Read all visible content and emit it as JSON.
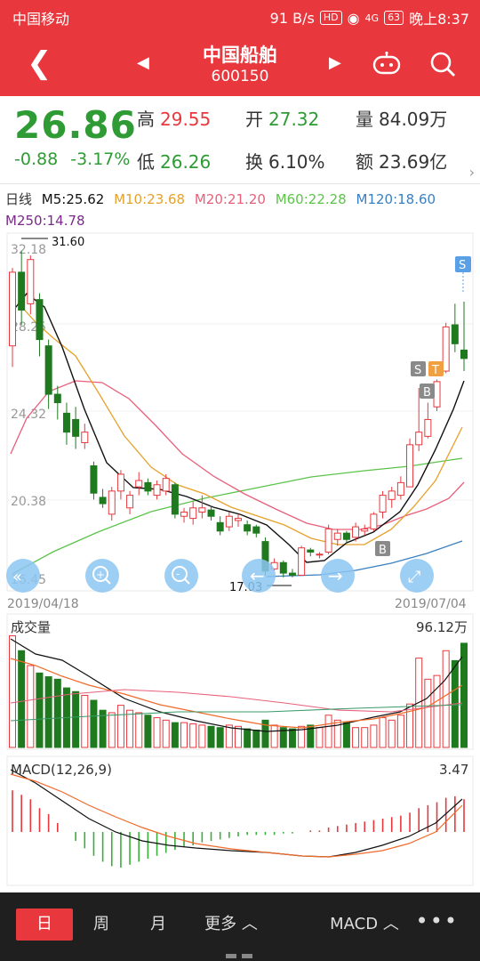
{
  "status_bar": {
    "carrier": "中国移动",
    "net_speed": "91 B/s",
    "hd": "HD",
    "signal": "4G",
    "battery": "63",
    "time": "晚上8:37"
  },
  "header": {
    "title": "中国船舶",
    "code": "600150"
  },
  "quote": {
    "price": "26.86",
    "change": "-0.88",
    "change_pct": "-3.17%",
    "high_label": "高",
    "high": "29.55",
    "low_label": "低",
    "low": "26.26",
    "open_label": "开",
    "open": "27.32",
    "turnover_label": "换",
    "turnover": "6.10%",
    "volume_label": "量",
    "volume": "84.09万",
    "amount_label": "额",
    "amount": "23.69亿"
  },
  "ma_legend": {
    "period": "日线",
    "items": [
      {
        "label": "M5:25.62",
        "color": "#111111"
      },
      {
        "label": "M10:23.68",
        "color": "#e6a12a"
      },
      {
        "label": "M20:21.20",
        "color": "#e85f7a"
      },
      {
        "label": "M60:22.28",
        "color": "#5cc44b"
      },
      {
        "label": "M120:18.60",
        "color": "#3a7fbf"
      },
      {
        "label": "M250:14.78",
        "color": "#7a2a8a"
      }
    ]
  },
  "chart": {
    "y_ticks": [
      "32.18",
      "28.25",
      "24.32",
      "20.38",
      "16.45"
    ],
    "max_marker": "31.60",
    "min_marker": "17.03",
    "date_start": "2019/04/18",
    "date_end": "2019/07/04",
    "volume_title": "成交量",
    "volume_max": "96.12万",
    "macd_title": "MACD(12,26,9)",
    "macd_max": "3.47",
    "signals": [
      "S",
      "S",
      "T",
      "B",
      "B"
    ]
  },
  "chart_data": {
    "type": "candlestick",
    "ylim": [
      16.45,
      32.18
    ],
    "candles": [
      [
        27.5,
        31.0,
        26.5,
        31.2
      ],
      [
        31.0,
        29.2,
        28.5,
        32.0
      ],
      [
        29.5,
        31.6,
        29.0,
        31.8
      ],
      [
        29.7,
        27.8,
        27.0,
        30.0
      ],
      [
        27.5,
        25.2,
        24.5,
        27.8
      ],
      [
        25.2,
        24.8,
        24.0,
        25.6
      ],
      [
        24.3,
        23.4,
        22.8,
        24.8
      ],
      [
        24.0,
        23.2,
        22.6,
        24.6
      ],
      [
        22.9,
        23.4,
        22.6,
        23.8
      ],
      [
        21.8,
        20.5,
        20.2,
        22.0
      ],
      [
        20.3,
        20.0,
        19.8,
        20.7
      ],
      [
        19.5,
        20.6,
        19.2,
        20.8
      ],
      [
        20.6,
        21.4,
        20.2,
        21.6
      ],
      [
        19.8,
        20.4,
        19.5,
        20.6
      ],
      [
        20.8,
        21.1,
        20.4,
        21.5
      ],
      [
        21.0,
        20.6,
        20.4,
        21.2
      ],
      [
        20.4,
        20.9,
        20.2,
        21.1
      ],
      [
        20.6,
        21.2,
        20.4,
        21.4
      ],
      [
        20.9,
        19.5,
        19.3,
        21.0
      ],
      [
        19.4,
        19.6,
        19.1,
        19.8
      ],
      [
        19.3,
        19.8,
        19.0,
        20.1
      ],
      [
        19.6,
        19.8,
        19.3,
        20.4
      ],
      [
        19.7,
        19.4,
        19.2,
        19.9
      ],
      [
        19.1,
        18.7,
        18.5,
        19.4
      ],
      [
        18.9,
        19.4,
        18.7,
        19.6
      ],
      [
        19.2,
        19.3,
        18.9,
        19.5
      ],
      [
        19.0,
        18.7,
        18.5,
        19.2
      ],
      [
        18.9,
        18.6,
        18.4,
        19.0
      ],
      [
        18.2,
        16.8,
        16.6,
        18.4
      ],
      [
        16.9,
        17.2,
        16.8,
        17.4
      ],
      [
        17.2,
        16.7,
        16.5,
        17.3
      ],
      [
        16.7,
        16.6,
        16.5,
        16.9
      ],
      [
        16.6,
        17.9,
        16.6,
        18.0
      ],
      [
        17.8,
        17.7,
        17.5,
        17.9
      ],
      [
        17.6,
        17.6,
        17.4,
        17.7
      ],
      [
        17.7,
        18.8,
        17.6,
        19.0
      ],
      [
        18.3,
        18.6,
        18.0,
        18.8
      ],
      [
        18.6,
        18.3,
        18.1,
        18.7
      ],
      [
        18.4,
        18.9,
        18.2,
        19.1
      ],
      [
        18.7,
        18.8,
        18.5,
        19.0
      ],
      [
        18.8,
        19.5,
        18.7,
        19.6
      ],
      [
        19.6,
        20.4,
        19.3,
        20.6
      ],
      [
        20.2,
        20.6,
        19.8,
        20.8
      ],
      [
        20.4,
        21.0,
        20.2,
        21.3
      ],
      [
        20.8,
        22.8,
        20.8,
        23.1
      ],
      [
        22.8,
        23.4,
        22.5,
        25.5
      ],
      [
        23.2,
        24.0,
        23.1,
        24.8
      ],
      [
        24.6,
        25.8,
        24.4,
        25.9
      ],
      [
        26.3,
        28.4,
        26.2,
        28.6
      ],
      [
        28.5,
        27.6,
        27.2,
        29.5
      ],
      [
        27.3,
        26.9,
        26.3,
        29.6
      ]
    ],
    "volume_ylim": [
      0,
      96.12
    ],
    "volumes": [
      90,
      78,
      66,
      60,
      57,
      55,
      48,
      45,
      42,
      38,
      30,
      28,
      34,
      30,
      28,
      26,
      24,
      22,
      20,
      20,
      19,
      18,
      17,
      16,
      18,
      17,
      15,
      14,
      22,
      18,
      16,
      15,
      17,
      18,
      16,
      26,
      22,
      20,
      16,
      16,
      18,
      24,
      22,
      26,
      35,
      72,
      55,
      58,
      78,
      70,
      84
    ],
    "macd_ylim": [
      -3.47,
      3.47
    ],
    "macd_hist": [
      2.8,
      2.5,
      2.2,
      1.6,
      1.2,
      0.6,
      0.0,
      -0.6,
      -1.1,
      -1.6,
      -2.0,
      -2.3,
      -2.4,
      -2.2,
      -2.0,
      -1.8,
      -1.6,
      -1.4,
      -1.2,
      -1.0,
      -0.9,
      -0.7,
      -0.6,
      -0.5,
      -0.4,
      -0.3,
      -0.2,
      -0.2,
      -0.2,
      -0.2,
      -0.1,
      -0.1,
      0.0,
      0.1,
      0.1,
      0.3,
      0.4,
      0.5,
      0.6,
      0.7,
      0.8,
      0.9,
      1.0,
      1.1,
      1.3,
      1.6,
      1.8,
      2.0,
      2.3,
      2.4,
      2.2
    ]
  },
  "controls": {
    "zoom_in": "+",
    "zoom_out": "-"
  },
  "bottom_tabs": {
    "day": "日",
    "week": "周",
    "month": "月",
    "more": "更多 ︿",
    "indicator": "MACD ︿",
    "menu": "•••"
  },
  "colors": {
    "up": "#e8383d",
    "down": "#1f7a1f",
    "bar_red": "#e8383d",
    "macd_dif": "#111111",
    "macd_dea": "#f06a2a"
  }
}
